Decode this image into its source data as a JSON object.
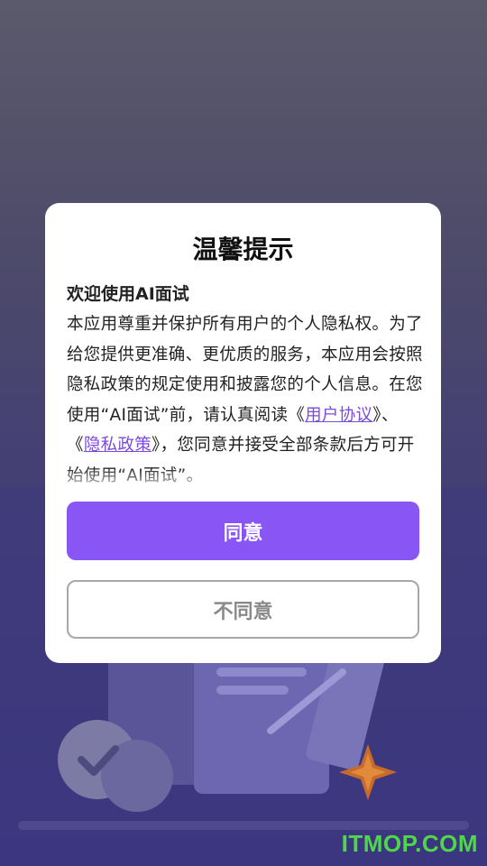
{
  "dialog": {
    "title": "温馨提示",
    "subtitle": "欢迎使用AI面试",
    "body_part1": "本应用尊重并保护所有用户的个人隐私权。为了给您提供更准确、更优质的服务，本应用会按照隐私政策的规定使用和披露您的个人信息。在您使用“AI面试”前，请认真阅读《",
    "link_user_agreement": "用户协议",
    "body_part2": "》、《",
    "link_privacy_policy": "隐私政策",
    "body_part3": "》，您同意并接受全部条款后方可开始使用“AI面试”。",
    "agree_label": "同意",
    "disagree_label": "不同意"
  },
  "watermark": "ITMOP.COM",
  "colors": {
    "accent": "#8a55f5",
    "link": "#7b4be0",
    "watermark": "#4fd64a"
  }
}
